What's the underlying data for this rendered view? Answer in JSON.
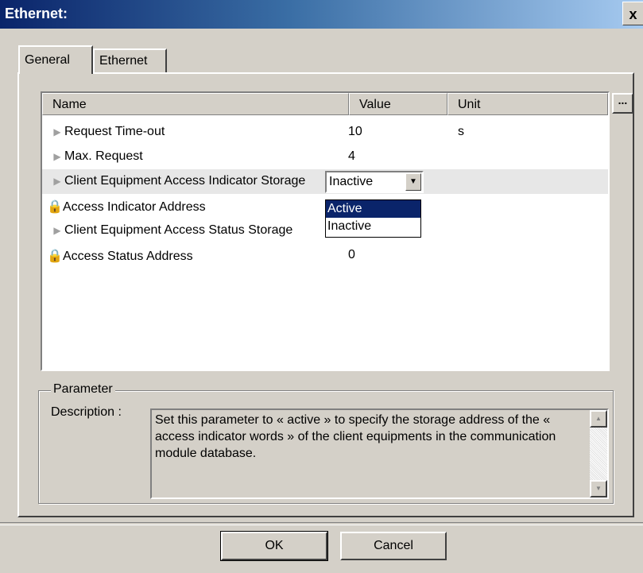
{
  "window": {
    "title": "Ethernet:",
    "close_label": "x"
  },
  "tabs": [
    {
      "label": "General"
    },
    {
      "label": "Ethernet"
    }
  ],
  "grid": {
    "columns": [
      "Name",
      "Value",
      "Unit"
    ],
    "more_label": "...",
    "rows": [
      {
        "name": "Request Time-out",
        "value": "10",
        "unit": "s",
        "icon": "pointer-icon"
      },
      {
        "name": "Max. Request",
        "value": "4",
        "unit": "",
        "icon": "pointer-icon"
      },
      {
        "name": "Client Equipment Access Indicator Storage",
        "value": "Inactive",
        "unit": "",
        "icon": "pointer-icon"
      },
      {
        "name": "Access Indicator Address",
        "value": "",
        "unit": "",
        "icon": "lock-icon"
      },
      {
        "name": "Client Equipment Access Status Storage",
        "value": "",
        "unit": "",
        "icon": "pointer-icon"
      },
      {
        "name": "Access Status Address",
        "value": "0",
        "unit": "",
        "icon": "lock-icon"
      }
    ]
  },
  "dropdown": {
    "selected": "Inactive",
    "options": [
      "Active",
      "Inactive"
    ],
    "highlighted": "Active"
  },
  "parameter": {
    "group_title": "Parameter",
    "desc_label": "Description :",
    "description": "Set this parameter to « active » to specify the storage address of the « access indicator words » of the client equipments in the communication module database."
  },
  "buttons": {
    "ok": "OK",
    "cancel": "Cancel"
  }
}
